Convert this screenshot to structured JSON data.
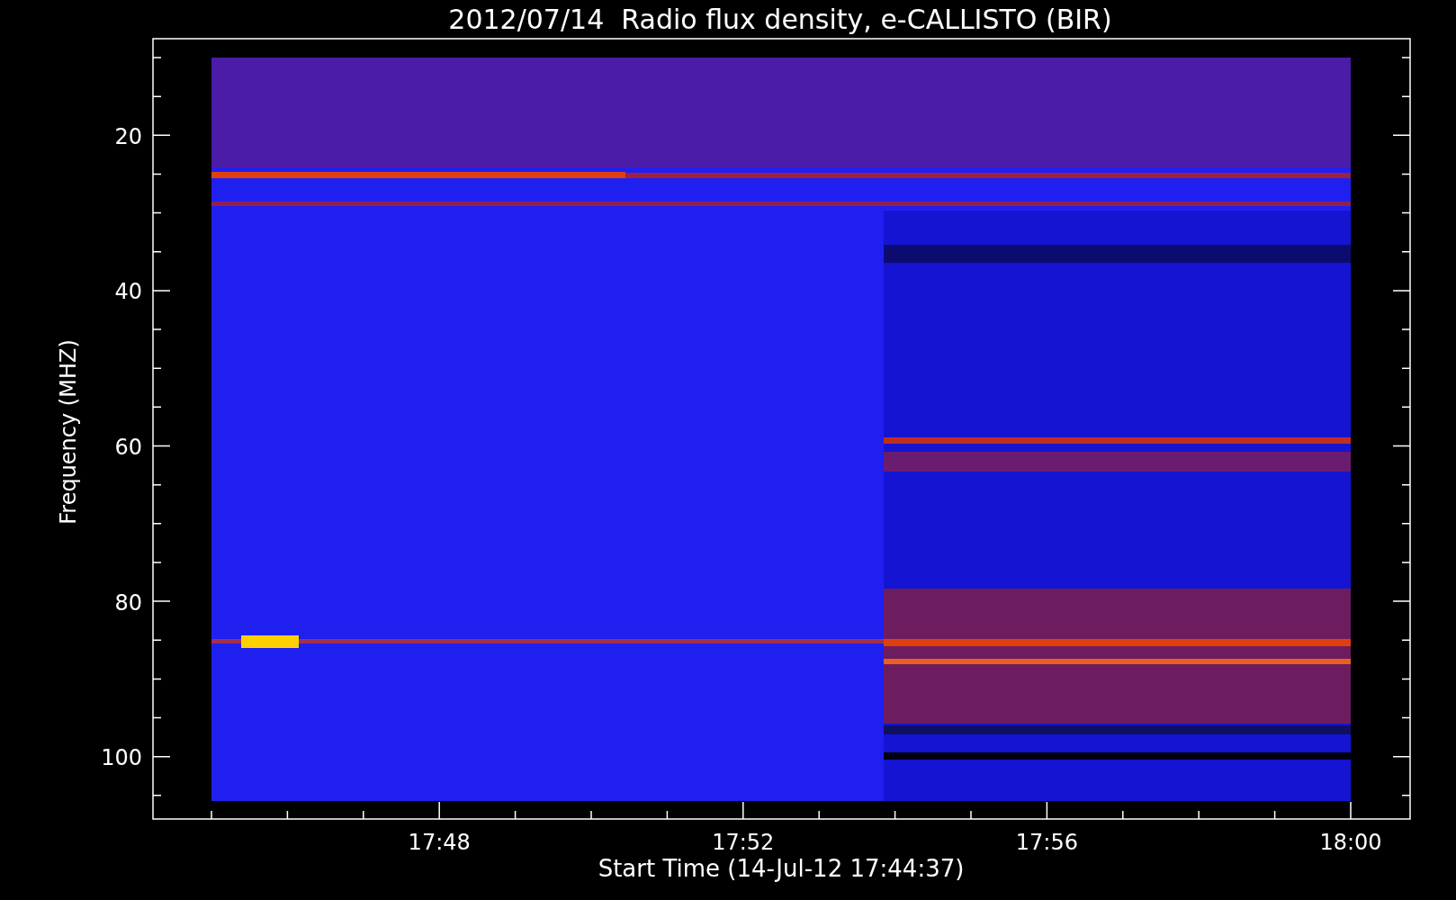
{
  "title": "2012/07/14  Radio flux density, e-CALLISTO (BIR)",
  "y_axis": {
    "label": "Frequency (MHZ)",
    "ticks": [
      "20",
      "40",
      "60",
      "80",
      "100"
    ]
  },
  "x_axis": {
    "label": "Start Time (14-Jul-12 17:44:37)",
    "ticks": [
      "17:48",
      "17:52",
      "17:56",
      "18:00"
    ]
  }
}
